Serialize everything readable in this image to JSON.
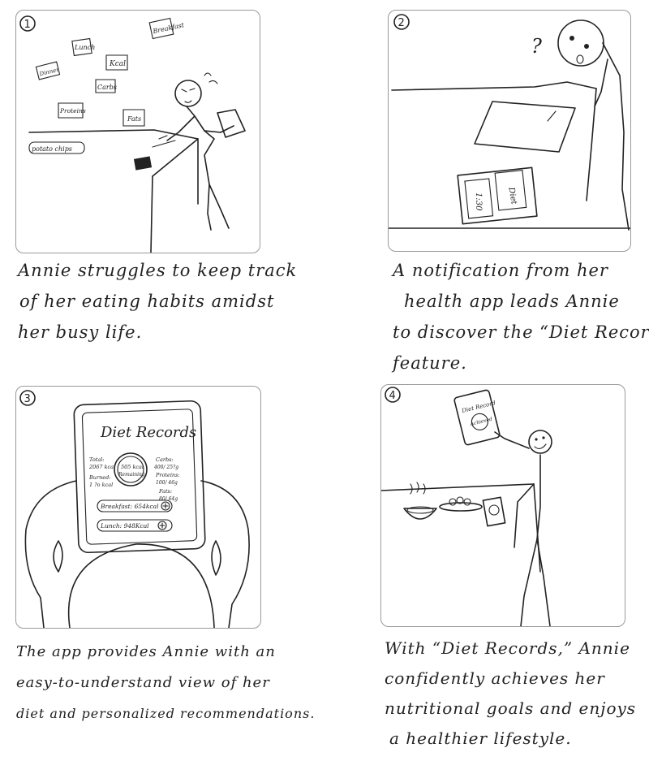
{
  "panels": [
    {
      "number": "1",
      "labels": {
        "breakfast": "Breakfast",
        "lunch": "Lunch",
        "kcal": "Kcal",
        "dinner": "Dinner",
        "carbs": "Carbs",
        "proteins": "Proteins",
        "fats": "Fats",
        "potato_chips": "potato chips"
      },
      "caption": [
        "Annie struggles to keep track",
        "of her eating habits amidst",
        "her busy life."
      ]
    },
    {
      "number": "2",
      "labels": {
        "phone_time": "1:30",
        "phone_app": "Diet"
      },
      "caption": [
        "A notification from her",
        "health app leads Annie",
        "to discover the “Diet Records”",
        "feature."
      ]
    },
    {
      "number": "3",
      "labels": {
        "title": "Diet Records",
        "total": "Total:",
        "total_value": "2067 kcal",
        "burned": "Burned:",
        "burned_value": "1 ?o kcal",
        "remaining_value": "505 kcal",
        "remaining_label": "Remaining",
        "carbs": "Carbs:",
        "carbs_value": "400/ 25?g",
        "proteins": "Proteins:",
        "proteins_value": "100/ 46g",
        "fats": "Fats:",
        "fats_value": "80/ 64g",
        "breakfast_row": "Breakfast: 654kcal",
        "lunch_row": "Lunch: 948Kcal"
      },
      "caption": [
        "The app provides Annie with an",
        "easy-to-understand view of her",
        "diet and personalized recommendations."
      ]
    },
    {
      "number": "4",
      "labels": {
        "app_title": "Diet Record",
        "app_badge": "Achieved"
      },
      "caption": [
        "With “Diet Records,” Annie",
        "confidently achieves her",
        "nutritional goals and enjoys",
        "a healthier lifestyle."
      ]
    }
  ]
}
